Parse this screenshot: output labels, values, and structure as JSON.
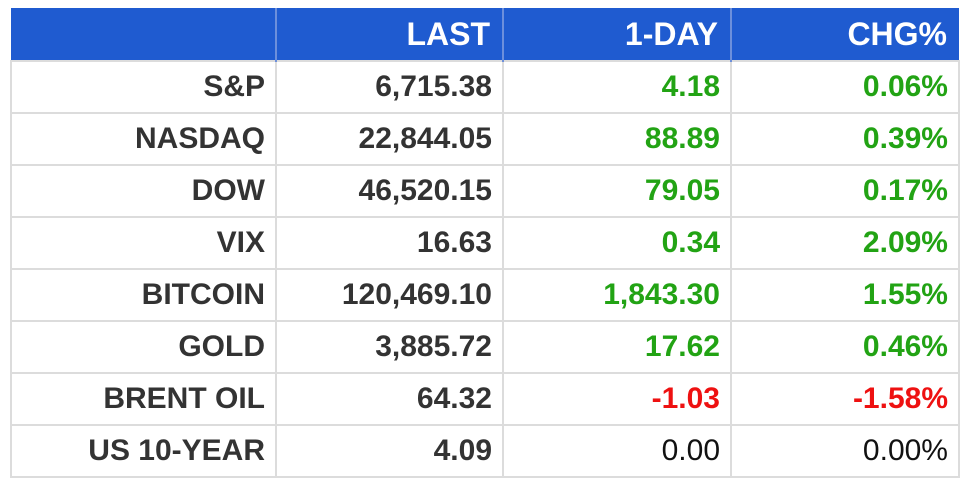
{
  "table": {
    "headers": [
      "",
      "LAST",
      "1-DAY",
      "CHG%"
    ],
    "rows": [
      {
        "name": "S&P",
        "last": "6,715.38",
        "day": "4.18",
        "chg": "0.06%",
        "dir": "up"
      },
      {
        "name": "NASDAQ",
        "last": "22,844.05",
        "day": "88.89",
        "chg": "0.39%",
        "dir": "up"
      },
      {
        "name": "DOW",
        "last": "46,520.15",
        "day": "79.05",
        "chg": "0.17%",
        "dir": "up"
      },
      {
        "name": "VIX",
        "last": "16.63",
        "day": "0.34",
        "chg": "2.09%",
        "dir": "up"
      },
      {
        "name": "BITCOIN",
        "last": "120,469.10",
        "day": "1,843.30",
        "chg": "1.55%",
        "dir": "up"
      },
      {
        "name": "GOLD",
        "last": "3,885.72",
        "day": "17.62",
        "chg": "0.46%",
        "dir": "up"
      },
      {
        "name": "BRENT OIL",
        "last": "64.32",
        "day": "-1.03",
        "chg": "-1.58%",
        "dir": "down"
      },
      {
        "name": "US 10-YEAR",
        "last": "4.09",
        "day": "0.00",
        "chg": "0.00%",
        "dir": "flat"
      }
    ]
  },
  "colors": {
    "header_bg": "#1f5bd0",
    "positive": "#22a314",
    "negative": "#ee1111",
    "unchanged": "#111111",
    "label": "#333333"
  }
}
